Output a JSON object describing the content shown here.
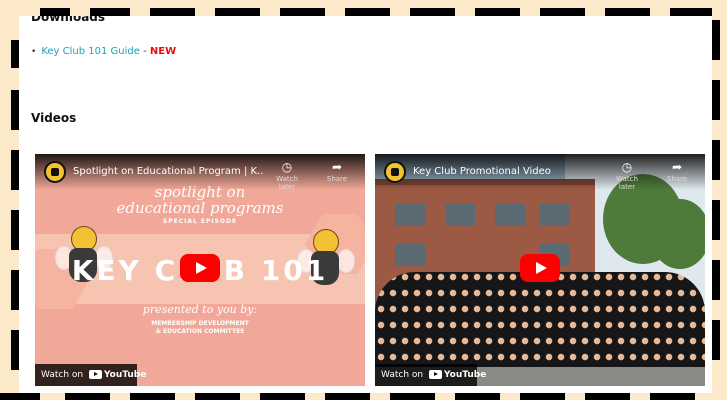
{
  "downloads": {
    "heading": "Downloads",
    "items": [
      {
        "link_text": "Key Club 101 Guide",
        "separator": "-",
        "badge": "NEW"
      }
    ]
  },
  "videos": {
    "heading": "Videos",
    "items": [
      {
        "title": "Spotlight on Educational Program | K...",
        "watch_later": "Watch later",
        "share": "Share",
        "watch_on": "Watch on",
        "yt_brand": "YouTube",
        "thumbnail_text": {
          "line1": "spotlight on",
          "line2": "educational programs",
          "line3": "SPECIAL EPISODE",
          "big": "KEY CLUB 101",
          "presented": "presented to you by:",
          "committee_line1": "MEMBERSHIP DEVELOPMENT",
          "committee_line2": "& EDUCATION COMMITTEE"
        }
      },
      {
        "title": "Key Club Promotional Video",
        "watch_later": "Watch later",
        "share": "Share",
        "watch_on": "Watch on",
        "yt_brand": "YouTube"
      }
    ]
  },
  "colors": {
    "link": "#1fa0b8",
    "badge": "#e01010",
    "youtube_red": "#ff0000",
    "page_border_bg": "#fbe9c9"
  },
  "icons": [
    "clock-icon",
    "share-arrow-icon",
    "play-icon",
    "youtube-logo-icon",
    "channel-logo-icon"
  ]
}
